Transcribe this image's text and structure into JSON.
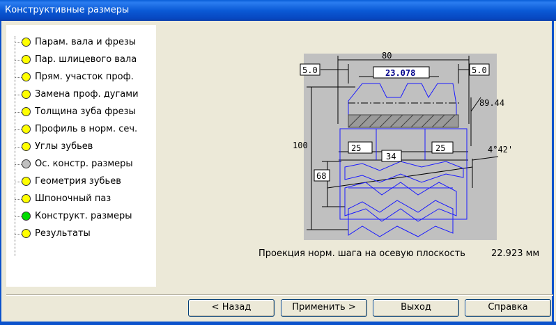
{
  "window": {
    "title": "Конструктивные размеры"
  },
  "tree": {
    "items": [
      {
        "label": "Парам. вала и фрезы",
        "status_color": "#ffff00"
      },
      {
        "label": "Пар. шлицевого вала",
        "status_color": "#ffff00"
      },
      {
        "label": "Прям. участок проф.",
        "status_color": "#ffff00"
      },
      {
        "label": "Замена проф. дугами",
        "status_color": "#ffff00"
      },
      {
        "label": "Толщина зуба фрезы",
        "status_color": "#ffff00"
      },
      {
        "label": "Профиль в норм. сеч.",
        "status_color": "#ffff00"
      },
      {
        "label": "Углы зубьев",
        "status_color": "#ffff00"
      },
      {
        "label": "Ос. констр. размеры",
        "status_color": "#c0c0c0"
      },
      {
        "label": "Геометрия зубьев",
        "status_color": "#ffff00"
      },
      {
        "label": "Шпоночный паз",
        "status_color": "#ffff00"
      },
      {
        "label": "Конструкт. размеры",
        "status_color": "#00dd00"
      },
      {
        "label": "Результаты",
        "status_color": "#ffff00"
      }
    ]
  },
  "drawing": {
    "dim_total_width": "80",
    "dim_left_offset": "5.0",
    "dim_right_offset": "5.0",
    "dim_step": "23.078",
    "dim_diameter": "89.44",
    "dim_height": "100",
    "dim_left_hub": "25",
    "dim_center": "34",
    "dim_right_hub": "25",
    "dim_bore": "68",
    "dim_angle": "4°42'"
  },
  "caption": {
    "text": "Проекция норм. шага на осевую плоскость",
    "value": "22.923 мм"
  },
  "buttons": {
    "back": "< Назад",
    "apply": "Применить >",
    "exit": "Выход",
    "help": "Справка"
  }
}
